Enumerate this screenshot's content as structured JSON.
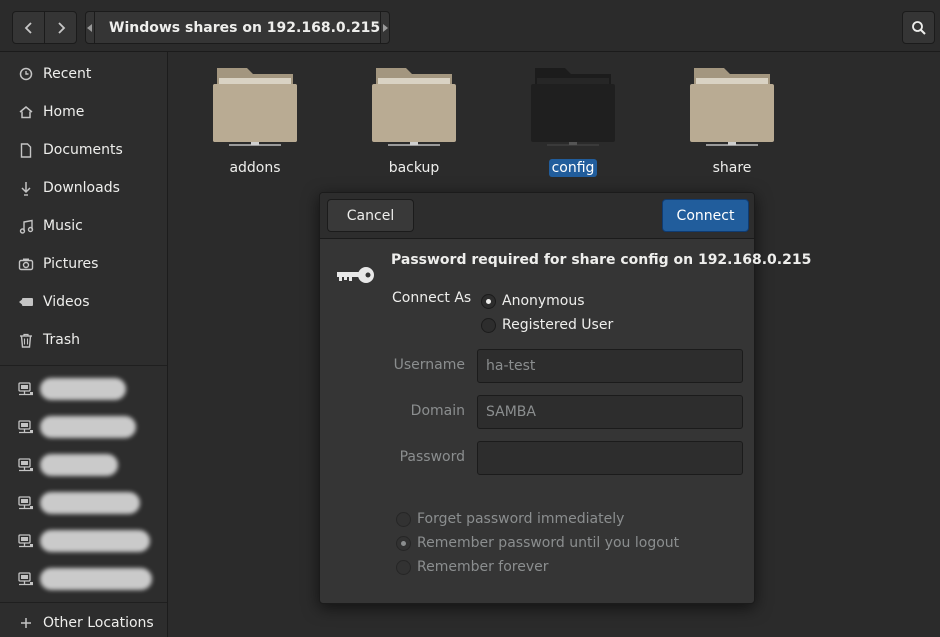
{
  "header": {
    "location_title": "Windows shares on 192.168.0.215"
  },
  "sidebar": {
    "items": [
      {
        "label": "Recent",
        "icon": "clock-icon"
      },
      {
        "label": "Home",
        "icon": "home-icon"
      },
      {
        "label": "Documents",
        "icon": "document-icon"
      },
      {
        "label": "Downloads",
        "icon": "download-icon"
      },
      {
        "label": "Music",
        "icon": "music-icon"
      },
      {
        "label": "Pictures",
        "icon": "camera-icon"
      },
      {
        "label": "Videos",
        "icon": "video-icon"
      },
      {
        "label": "Trash",
        "icon": "trash-icon"
      }
    ],
    "network_items_count_label": "",
    "other_locations": "Other Locations"
  },
  "files": [
    {
      "name": "addons",
      "selected": false
    },
    {
      "name": "backup",
      "selected": false
    },
    {
      "name": "config",
      "selected": true
    },
    {
      "name": "share",
      "selected": false
    }
  ],
  "dialog": {
    "cancel_label": "Cancel",
    "connect_label": "Connect",
    "title": "Password required for share config on 192.168.0.215",
    "connect_as_label": "Connect As",
    "connect_as_options": [
      {
        "label": "Anonymous",
        "checked": true
      },
      {
        "label": "Registered User",
        "checked": false
      }
    ],
    "fields": {
      "username": {
        "label": "Username",
        "value": "ha-test"
      },
      "domain": {
        "label": "Domain",
        "value": "SAMBA"
      },
      "password": {
        "label": "Password",
        "value": ""
      }
    },
    "remember_options": [
      {
        "label": "Forget password immediately",
        "checked": false
      },
      {
        "label": "Remember password until you logout",
        "checked": true
      },
      {
        "label": "Remember forever",
        "checked": false
      }
    ]
  },
  "colors": {
    "accent": "#215d9c",
    "folder": "#b8a991",
    "background": "#2d2d2d"
  }
}
